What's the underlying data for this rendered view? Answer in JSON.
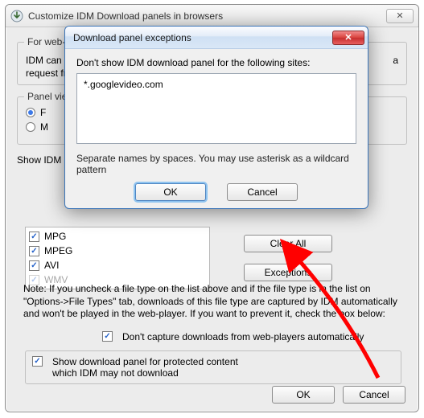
{
  "parent": {
    "title": "Customize IDM Download panels in browsers",
    "close_glyph": "✕",
    "group_webp": "For web-p",
    "desc_line1": "IDM can",
    "desc_line2": "request fr",
    "desc_suffix_a": "a",
    "group_panelview": "Panel vie",
    "radio_f": "F",
    "radio_m": "M",
    "show_idm": "Show IDM",
    "files": {
      "mpg": "MPG",
      "mpeg": "MPEG",
      "avi": "AVI",
      "wmv": "WMV"
    },
    "buttons": {
      "clear_all": "Clear All",
      "exceptions": "Exceptions"
    },
    "note": "Note: If you uncheck a file type on the list above and if the file type is in the list on \"Options->File Types\" tab, downloads of this file type are captured by IDM automatically and won't be played in the web-player. If you want to prevent it, check the box below:",
    "dontcapture": "Don't capture downloads from web-players automatically",
    "showprot_line1": "Show download panel for protected content",
    "showprot_line2": "which IDM may not download",
    "ok": "OK",
    "cancel": "Cancel"
  },
  "modal": {
    "title": "Download panel exceptions",
    "close_glyph": "✕",
    "label": "Don't show IDM download panel for the following sites:",
    "textarea_value": "*.googlevideo.com",
    "help": "Separate names by spaces. You may use asterisk as a wildcard pattern",
    "ok": "OK",
    "cancel": "Cancel"
  }
}
